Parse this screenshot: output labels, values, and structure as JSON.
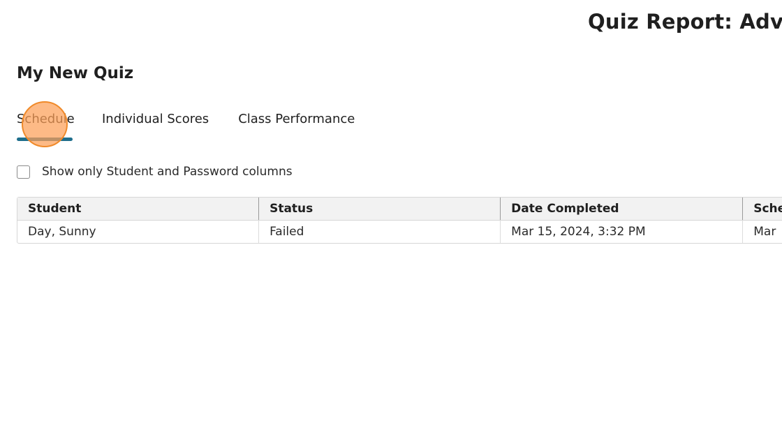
{
  "header": {
    "report_title": "Quiz Report: Advanc"
  },
  "quiz": {
    "title": "My New Quiz"
  },
  "tabs": [
    {
      "label": "Schedule",
      "active": true
    },
    {
      "label": "Individual Scores",
      "active": false
    },
    {
      "label": "Class Performance",
      "active": false
    }
  ],
  "filter": {
    "label": "Show only Student and Password columns",
    "checked": false
  },
  "table": {
    "columns": [
      "Student",
      "Status",
      "Date Completed",
      "Sche"
    ],
    "rows": [
      [
        "Day, Sunny",
        "Failed",
        "Mar 15, 2024, 3:32 PM",
        "Mar"
      ]
    ]
  },
  "colors": {
    "accent": "#1e6e8c",
    "click_marker": "#fca058"
  }
}
